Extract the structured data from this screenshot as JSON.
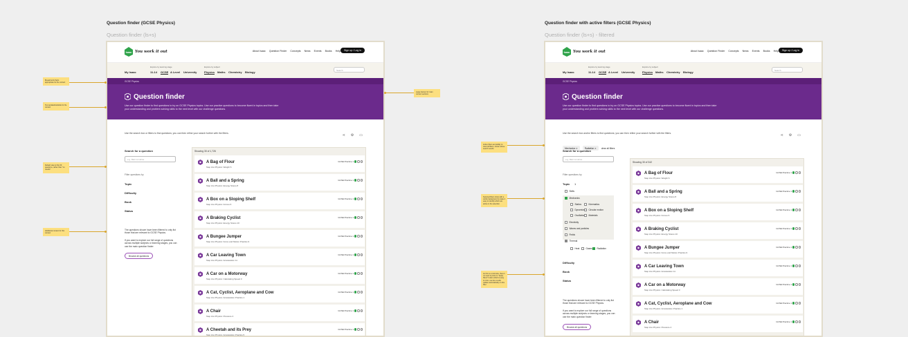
{
  "boards": [
    {
      "title": "Question finder (GCSE Physics)",
      "subtitle": "Question finder (ls+s)",
      "intro": "Use the search box or filters to find questions; you can then refine your search further with the filters.",
      "count": "Showing 30 of 1,726",
      "annotations": [
        "Breadcrumb that's appropriate for the context",
        "Text updated/variable for the context",
        "Default view is first 30 questions, rather than \"no results\"",
        "Additional content for this context",
        "Large banner for main context sections"
      ]
    },
    {
      "title": "Question finder with active filters (GCSE Physics)",
      "subtitle": "Question finder (ls+s) - filtered",
      "intro": "Use the search box and/or filters to find questions; you can then refine your search further with the filters.",
      "count": "Showing 30 of 342",
      "annotations": [
        "Active filters and ability to clear all filters, shown above search results",
        "Selected filters show with a subtle background to make it easy to identify which are active in the selection",
        "As this is a microsite, there's no need to pivot on \"Apply filters\" button which is easy to miss; use live results update automatically on this filter"
      ]
    }
  ],
  "site": {
    "logo_text": "Isaac",
    "logo_tagline": "You work it out",
    "nav": [
      "About Isaac",
      "Question Finder",
      "Concepts",
      "News",
      "Events",
      "Books",
      "Help"
    ],
    "sign_in": "Sign up / Log in",
    "home": "My Isaac",
    "stage_label": "Explore by learning stage",
    "stages": [
      "11-14",
      "GCSE",
      "A Level",
      "University"
    ],
    "subject_label": "Explore by subject",
    "subjects": [
      "Physics",
      "Maths",
      "Chemistry",
      "Biology"
    ],
    "search_placeholder": "Search",
    "crumb": "GCSE Physics",
    "hero_title": "Question finder",
    "hero_text": "Use our question finder to find questions to try on GCSE Physics topics. Use our practice questions to become fluent in topics and then take your understanding and problem solving skills to the next level with our challenge questions.",
    "search_label": "Search for a question",
    "search_input_placeholder": "e.g. Man vs Horse",
    "filter_questions": "Filter questions by",
    "filters": [
      "Topic",
      "Difficulty",
      "Book",
      "Status"
    ],
    "side_text": "The questions shown have been filtered to only list those that are relevant to GCSE Physics.",
    "side_text2": "If you want to explore our full range of questions across multiple subjects or learning stages, you can use the main question finder:",
    "browse_btn": "Browse all questions",
    "tag": "GCSE Practice 1"
  },
  "questions_a": [
    {
      "title": "A Bag of Flour",
      "sub": "Step into Physics: Weight 6"
    },
    {
      "title": "A Ball and a Spring",
      "sub": "Step into Physics: Energy Stores 8"
    },
    {
      "title": "A Box on a Sloping Shelf",
      "sub": "Step into Physics: Forces 6"
    },
    {
      "title": "A Braking Cyclist",
      "sub": "Step into Physics: Energy Stores 10"
    },
    {
      "title": "A Bungee Jumper",
      "sub": "Step into Physics: Force and Motion Practice 9"
    },
    {
      "title": "A Car Leaving Town",
      "sub": "Step into Physics: Acceleration 11"
    },
    {
      "title": "A Car on a Motorway",
      "sub": "Step into Physics: Calculating Speed 3"
    },
    {
      "title": "A Cat, Cyclist, Aeroplane and Cow",
      "sub": "Step into Physics: Acceleration Practice 1"
    },
    {
      "title": "A Chair",
      "sub": "Step into Physics: Pressure 4"
    },
    {
      "title": "A Cheetah and its Prey",
      "sub": "Step into Physics: Acceleration Practice 5"
    }
  ],
  "questions_b": [
    {
      "title": "A Bag of Flour",
      "sub": "Step into Physics: Weight 6"
    },
    {
      "title": "A Ball and a Spring",
      "sub": "Step into Physics: Energy Stores 8"
    },
    {
      "title": "A Box on a Sloping Shelf",
      "sub": "Step into Physics: Forces 6"
    },
    {
      "title": "A Braking Cyclist",
      "sub": "Step into Physics: Energy Stores 10"
    },
    {
      "title": "A Bungee Jumper",
      "sub": "Step into Physics: Force and Motion Practice 9"
    },
    {
      "title": "A Car Leaving Town",
      "sub": "Step into Physics: Acceleration 11"
    },
    {
      "title": "A Car on a Motorway",
      "sub": "Step into Physics: Calculating Speed 3"
    },
    {
      "title": "A Cat, Cyclist, Aeroplane and Cow",
      "sub": "Step into Physics: Acceleration Practice 1"
    },
    {
      "title": "A Chair",
      "sub": "Step into Physics: Pressure 4"
    }
  ],
  "active_filters": {
    "chips": [
      "Mechanics ✕",
      "Radiation ✕"
    ],
    "clear": "clear all filters",
    "topic_count": "1",
    "options": [
      "Skills",
      "Mechanics",
      "Statics",
      "Kinematics",
      "Dynamics",
      "Circular motion",
      "Oscillations",
      "Materials",
      "Electricity",
      "Waves and particles",
      "Fields",
      "Thermal",
      "Heat",
      "Gases",
      "Radiation"
    ]
  },
  "colors": {
    "brand_purple": "#5c1f78",
    "accent_green": "#2fa34a",
    "note_yellow": "#fcdf7f"
  }
}
